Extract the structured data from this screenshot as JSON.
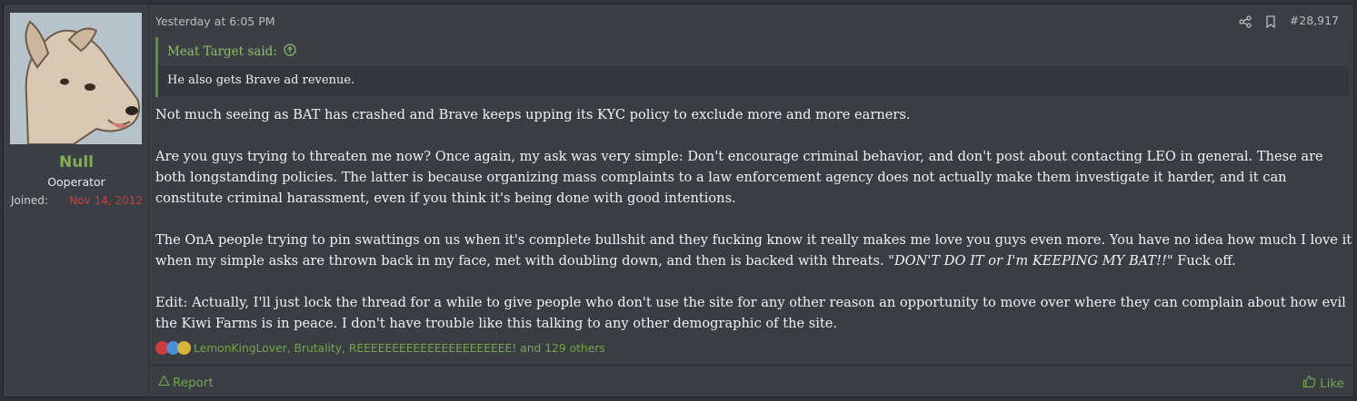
{
  "post": {
    "date": "Yesterday at 6:05 PM",
    "number": "#28,917",
    "icons": [
      "share-icon",
      "bookmark-icon"
    ]
  },
  "user": {
    "name": "Null",
    "title": "Ooperator",
    "joined_label": "Joined:",
    "joined_value": "Nov 14, 2012",
    "colors": {
      "name": "#7fb04f",
      "joined": "#c0433f"
    }
  },
  "quote": {
    "author": "Meat Target said:",
    "text": "He also gets Brave ad revenue."
  },
  "message": {
    "p1": "Not much seeing as BAT has crashed and Brave keeps upping its KYC policy to exclude more and more earners.",
    "p2": "Are you guys trying to threaten me now? Once again, my ask was very simple: Don't encourage criminal behavior, and don't post about contacting LEO in general. These are both longstanding policies. The latter is because organizing mass complaints to a law enforcement agency does not actually make them investigate it harder, and it can constitute criminal harassment, even if you think it's being done with good intentions.",
    "p3_before": "The OnA people trying to pin swattings on us when it's complete bullshit and they fucking know it really makes me love you guys even more. You have no idea how much I love it when my simple asks are thrown back in my face, met with doubling down, and then is backed with threats. \"",
    "p3_italic": "DON'T DO IT or I'm KEEPING MY BAT!!",
    "p3_after": "\" Fuck off.",
    "p4": "Edit: Actually, I'll just lock the thread for a while to give people who don't use the site for any other reason an opportunity to move over where they can complain about how evil the Kiwi Farms is in peace. I don't have trouble like this talking to any other demographic of the site."
  },
  "reactions": {
    "icons": [
      "heart-reaction-icon",
      "like-reaction-icon",
      "winner-reaction-icon"
    ],
    "text": "LemonKingLover, Brutality, REEEEEEEEEEEEEEEEEEEEEE! and 129 others"
  },
  "footer": {
    "report_label": "Report",
    "like_label": "Like"
  },
  "colors": {
    "accent": "#72a64a",
    "background": "#3a3d42",
    "quote_border": "#5c8f3e"
  }
}
